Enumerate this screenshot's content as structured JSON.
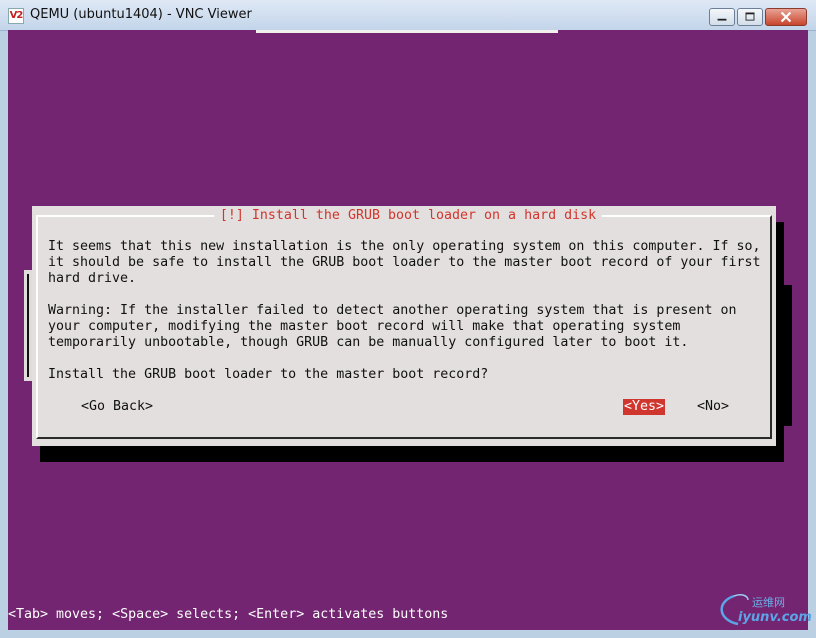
{
  "window": {
    "icon_text": "V2",
    "title": "QEMU (ubuntu1404) - VNC Viewer"
  },
  "dialog": {
    "title": "[!] Install the GRUB boot loader on a hard disk",
    "paragraph1": [
      "It seems that this new installation is the only operating system on this computer. If so,",
      "it should be safe to install the GRUB boot loader to the master boot record of your first",
      "hard drive."
    ],
    "paragraph2": [
      "Warning: If the installer failed to detect another operating system that is present on",
      "your computer, modifying the master boot record will make that operating system",
      "temporarily unbootable, though GRUB can be manually configured later to boot it."
    ],
    "question": "Install the GRUB boot loader to the master boot record?",
    "buttons": {
      "go_back": "<Go Back>",
      "yes": "<Yes>",
      "no": "<No>"
    }
  },
  "status_hint": "<Tab> moves; <Space> selects; <Enter> activates buttons",
  "watermark": {
    "line1": "运维网",
    "line2": "iyunv.com"
  },
  "colors": {
    "background": "#742571",
    "dialog": "#e3dfde",
    "accent_red": "#d0362d",
    "hint_text": "#ffffff"
  }
}
